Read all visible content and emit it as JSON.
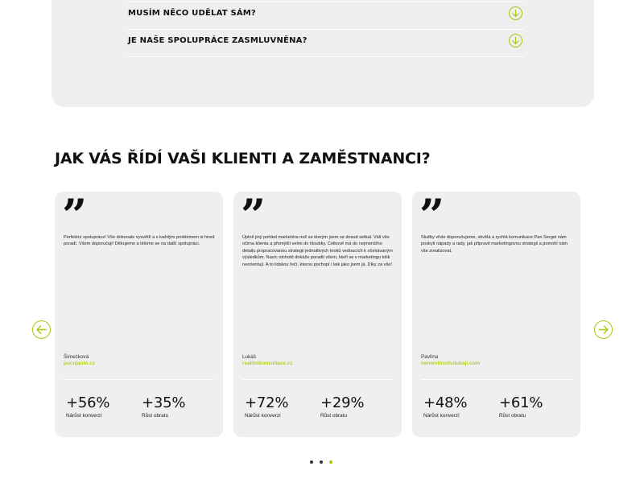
{
  "faq": {
    "items": [
      {
        "question": "MUSÍM NĚCO UDĚLAT SÁM?"
      },
      {
        "question": "JE NAŠE SPOLUPRÁCE ZASMLUVNĚNA?"
      }
    ]
  },
  "testimonials": {
    "title": "JAK VÁS ŘÍDÍ VAŠI KLIENTI A ZAMĚSTNANCI?",
    "quote_symbol": "”",
    "cards": [
      {
        "text": "Perfektní spolupráce! Vše dokonale vysvětlí a s každým problémem si hned poradí. Všem doporučuji! Děkujeme a těšíme se na další spolupráci.",
        "author": "Šimečková",
        "site": "pucujauto.cz",
        "stats": [
          {
            "value": "+56%",
            "label": "Nárůst konverzí"
          },
          {
            "value": "+35%",
            "label": "Růst obratu"
          }
        ]
      },
      {
        "text": "Úplně jiný pohled marketéra než se kterým jsem se dosud setkal. Vidí vše očima klienta a přemýšlí velmi do hloubky. Celkově má do nejmenšího detailu propracovanou strategii jednotlivých kroků vedoucích k očekávaným výsledkům. Navíc otchotě dokáže poradit všem, kteří se v marketingu tolik neorientují. A to lidskou řečí, kterou pochopí i laik jako jsem já. Díky za vše!",
        "author": "Lukáš",
        "site": "realitnikonzultace.cz",
        "stats": [
          {
            "value": "+72%",
            "label": "Nárůst konverzí"
          },
          {
            "value": "+29%",
            "label": "Růst obratu"
          }
        ]
      },
      {
        "text": "Služby vřele doporučujeme, skvělá a rychlá komunikace Pan Sergei nám poskytl nápady a rady, jak připravit marketingovou strategii a pomohl nám vše zrealizovat.",
        "author": "Pavlína",
        "site": "nemovitostivdubaji.com",
        "stats": [
          {
            "value": "+48%",
            "label": "Nárůst konverzí"
          },
          {
            "value": "+61%",
            "label": "Růst obratu"
          }
        ]
      }
    ],
    "pagination": {
      "total": 3,
      "active": 3
    }
  },
  "colors": {
    "accent": "#a4c90f",
    "link": "#b5d119",
    "card_bg": "#efefef"
  }
}
